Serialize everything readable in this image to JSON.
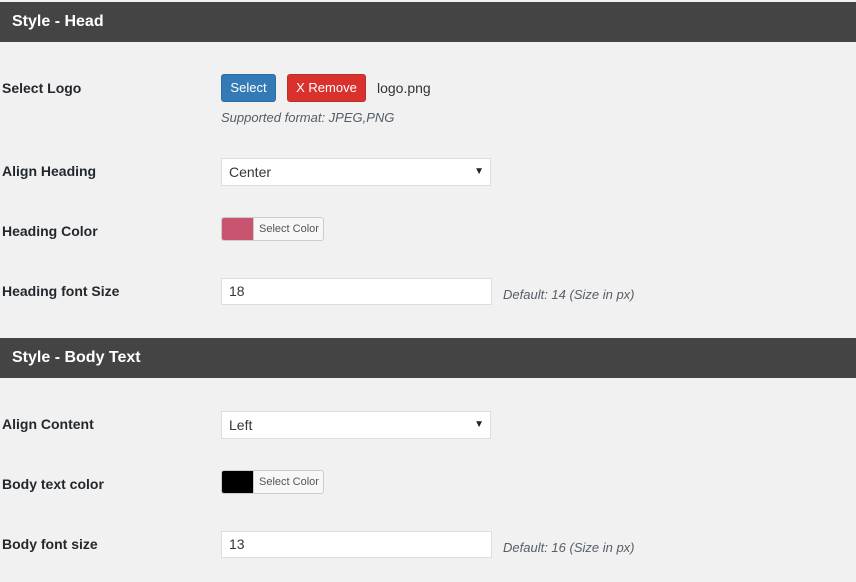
{
  "sections": {
    "head": {
      "title": "Style - Head",
      "select_logo_label": "Select Logo",
      "select_button": "Select",
      "remove_button": "X Remove",
      "logo_filename": "logo.png",
      "supported_format": "Supported format: JPEG,PNG",
      "align_heading_label": "Align Heading",
      "align_heading_value": "Center",
      "heading_color_label": "Heading Color",
      "heading_color_value": "#c85470",
      "heading_color_button": "Select Color",
      "heading_font_size_label": "Heading font Size",
      "heading_font_size_value": "18",
      "heading_font_size_hint": "Default: 14 (Size in px)"
    },
    "body": {
      "title": "Style - Body Text",
      "align_content_label": "Align Content",
      "align_content_value": "Left",
      "body_color_label": "Body text color",
      "body_color_value": "#000000",
      "body_color_button": "Select Color",
      "body_font_size_label": "Body font size",
      "body_font_size_value": "13",
      "body_font_size_hint": "Default: 16 (Size in px)"
    }
  },
  "icons": {
    "dropdown": "chevron-down-icon"
  },
  "colors": {
    "header_bg": "#444444",
    "page_bg": "#f1f1f1",
    "select_button_bg": "#337ab7",
    "remove_button_bg": "#d9312d"
  }
}
